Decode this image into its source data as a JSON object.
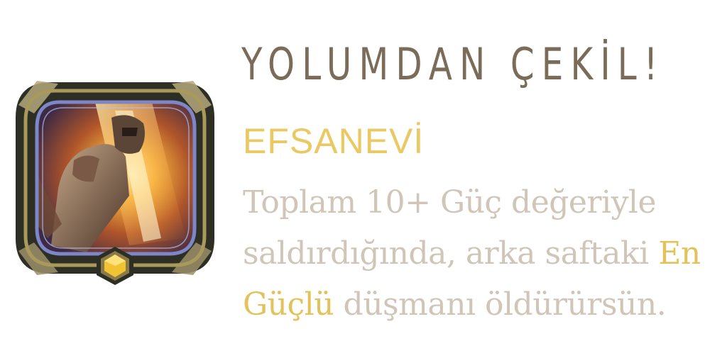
{
  "card": {
    "title": "YOLUMDAN ÇEKİL!",
    "rarity": "EFSANEVİ",
    "description": {
      "line1": "Toplam 10+ Güç değeriyle",
      "line2_pre": "saldırdığında, arka saftaki ",
      "line2_kw": "En",
      "line3_kw": "Güçlü",
      "line3_post": " düşmanı öldürürsün."
    },
    "icon": "armored-champion-portrait",
    "gem_icon": "hexagon-gem-icon",
    "colors": {
      "title": "#7a6c58",
      "rarity": "#eac964",
      "text": "#cfc6b8",
      "keyword": "#e2c25b",
      "frame_dark": "#2b2d22",
      "frame_gold": "#a99a5c",
      "frame_inner": "#7e86c8"
    }
  }
}
